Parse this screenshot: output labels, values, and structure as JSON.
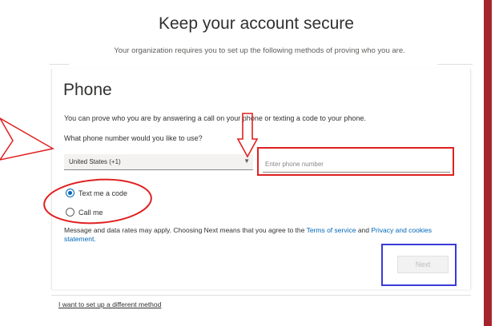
{
  "page": {
    "title": "Keep your account secure",
    "subtitle": "Your organization requires you to set up the following methods of proving who you are."
  },
  "phone_section": {
    "heading": "Phone",
    "description": "You can prove who you are by answering a call on your phone or texting a code to your phone.",
    "question": "What phone number would you like to use?",
    "country_value": "United States (+1)",
    "phone_placeholder": "Enter phone number",
    "options": [
      "Text me a code",
      "Call me"
    ],
    "selected_option": "Text me a code",
    "rates_text": "Message and data rates may apply. Choosing Next means that you agree to the",
    "terms_link": "Terms of service",
    "and_text": "and",
    "privacy_link": "Privacy and cookies statement.",
    "next_label": "Next"
  },
  "footer": {
    "different_method_link": "I want to set up a different method"
  },
  "colors": {
    "accent": "#0067b8",
    "annotation_red": "#e02020",
    "annotation_blue": "#3a3ad8",
    "sidebar_red": "#a4262c"
  }
}
